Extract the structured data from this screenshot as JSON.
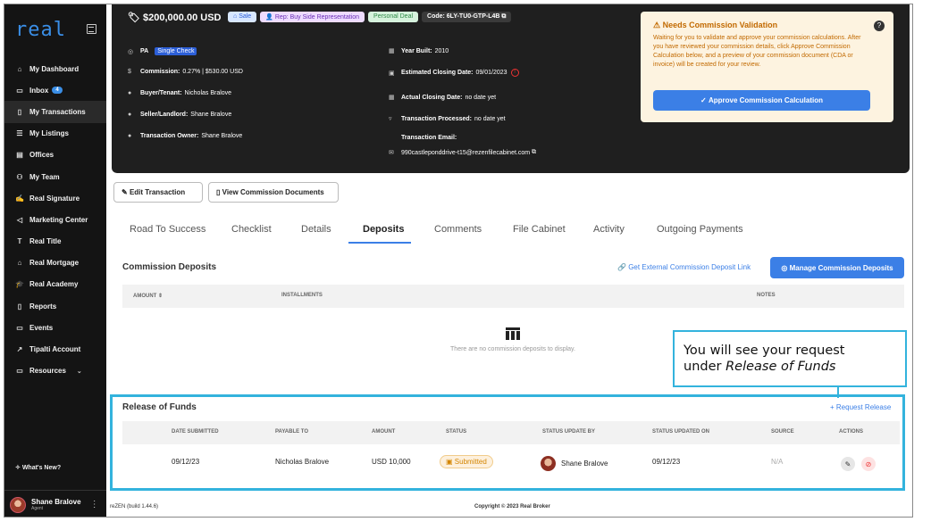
{
  "sidebar": {
    "logo": "real",
    "items": [
      {
        "label": "My Dashboard",
        "icon": "⌂"
      },
      {
        "label": "Inbox",
        "icon": "▭",
        "badge": "4"
      },
      {
        "label": "My Transactions",
        "icon": "▯"
      },
      {
        "label": "My Listings",
        "icon": "☰"
      },
      {
        "label": "Offices",
        "icon": "▤"
      },
      {
        "label": "My Team",
        "icon": "⚇"
      },
      {
        "label": "Real Signature",
        "icon": "✍"
      },
      {
        "label": "Marketing Center",
        "icon": "◁"
      },
      {
        "label": "Real Title",
        "icon": "T"
      },
      {
        "label": "Real Mortgage",
        "icon": "⌂"
      },
      {
        "label": "Real Academy",
        "icon": "🎓"
      },
      {
        "label": "Reports",
        "icon": "▯"
      },
      {
        "label": "Events",
        "icon": "▭"
      },
      {
        "label": "Tipalti Account",
        "icon": "↗"
      },
      {
        "label": "Resources",
        "icon": "▭"
      }
    ],
    "whats_new": "What's New?",
    "user": {
      "name": "Shane Bralove",
      "role": "Agent"
    }
  },
  "header": {
    "price": "$200,000.00 USD",
    "tags": {
      "sale": "Sale",
      "rep": "Rep: Buy Side Representation",
      "personal": "Personal Deal",
      "code": "Code: 6LY-TU0-GTP-L4B"
    },
    "state": "PA",
    "single_check": "Single Check",
    "commission": {
      "label": "Commission:",
      "value": "0.27% | $530.00 USD"
    },
    "buyer": {
      "label": "Buyer/Tenant:",
      "value": "Nicholas Bralove"
    },
    "seller": {
      "label": "Seller/Landlord:",
      "value": "Shane Bralove"
    },
    "owner": {
      "label": "Transaction Owner:",
      "value": "Shane Bralove"
    },
    "year_built": {
      "label": "Year Built:",
      "value": "2010"
    },
    "est_closing": {
      "label": "Estimated Closing Date:",
      "value": "09/01/2023"
    },
    "actual_closing": {
      "label": "Actual Closing Date:",
      "value": "no date yet"
    },
    "processed": {
      "label": "Transaction Processed:",
      "value": "no date yet"
    },
    "email": {
      "label": "Transaction Email:",
      "value": "990castleponddrive-t15@rezenfilecabinet.com"
    }
  },
  "validation": {
    "title": "Needs Commission Validation",
    "body": "Waiting for you to validate and approve your commission calculations. After you have reviewed your commission details, click Approve Commission Calculation below, and a preview of your commission document (CDA or invoice) will be created for your review.",
    "button": "Approve Commission Calculation"
  },
  "actions": {
    "edit": "Edit Transaction",
    "view_docs": "View Commission Documents"
  },
  "tabs": [
    "Road To Success",
    "Checklist",
    "Details",
    "Deposits",
    "Comments",
    "File Cabinet",
    "Activity",
    "Outgoing Payments"
  ],
  "deposits": {
    "title": "Commission Deposits",
    "external_link": "Get External Commission Deposit Link",
    "manage_button": "Manage Commission Deposits",
    "columns": {
      "amount": "AMOUNT",
      "installments": "INSTALLMENTS",
      "notes": "NOTES"
    },
    "empty": "There are no commission deposits to display."
  },
  "callout": {
    "line1": "You will see your request",
    "line2_prefix": "under ",
    "line2_em": "Release of Funds"
  },
  "release": {
    "title": "Release of Funds",
    "request_link": "Request Release",
    "columns": [
      "DATE SUBMITTED",
      "PAYABLE TO",
      "AMOUNT",
      "STATUS",
      "STATUS UPDATE BY",
      "STATUS UPDATED ON",
      "SOURCE",
      "ACTIONS"
    ],
    "row": {
      "date": "09/12/23",
      "payable": "Nicholas Bralove",
      "amount": "USD 10,000",
      "status": "Submitted",
      "updated_by": "Shane Bralove",
      "updated_on": "09/12/23",
      "source": "N/A"
    }
  },
  "footer": {
    "build": "reZEN (build 1.44.6)",
    "copyright": "Copyright © 2023 Real Broker"
  },
  "colors": {
    "accent": "#3b7fe6",
    "callout": "#33b3dd",
    "warning": "#c26a00"
  }
}
